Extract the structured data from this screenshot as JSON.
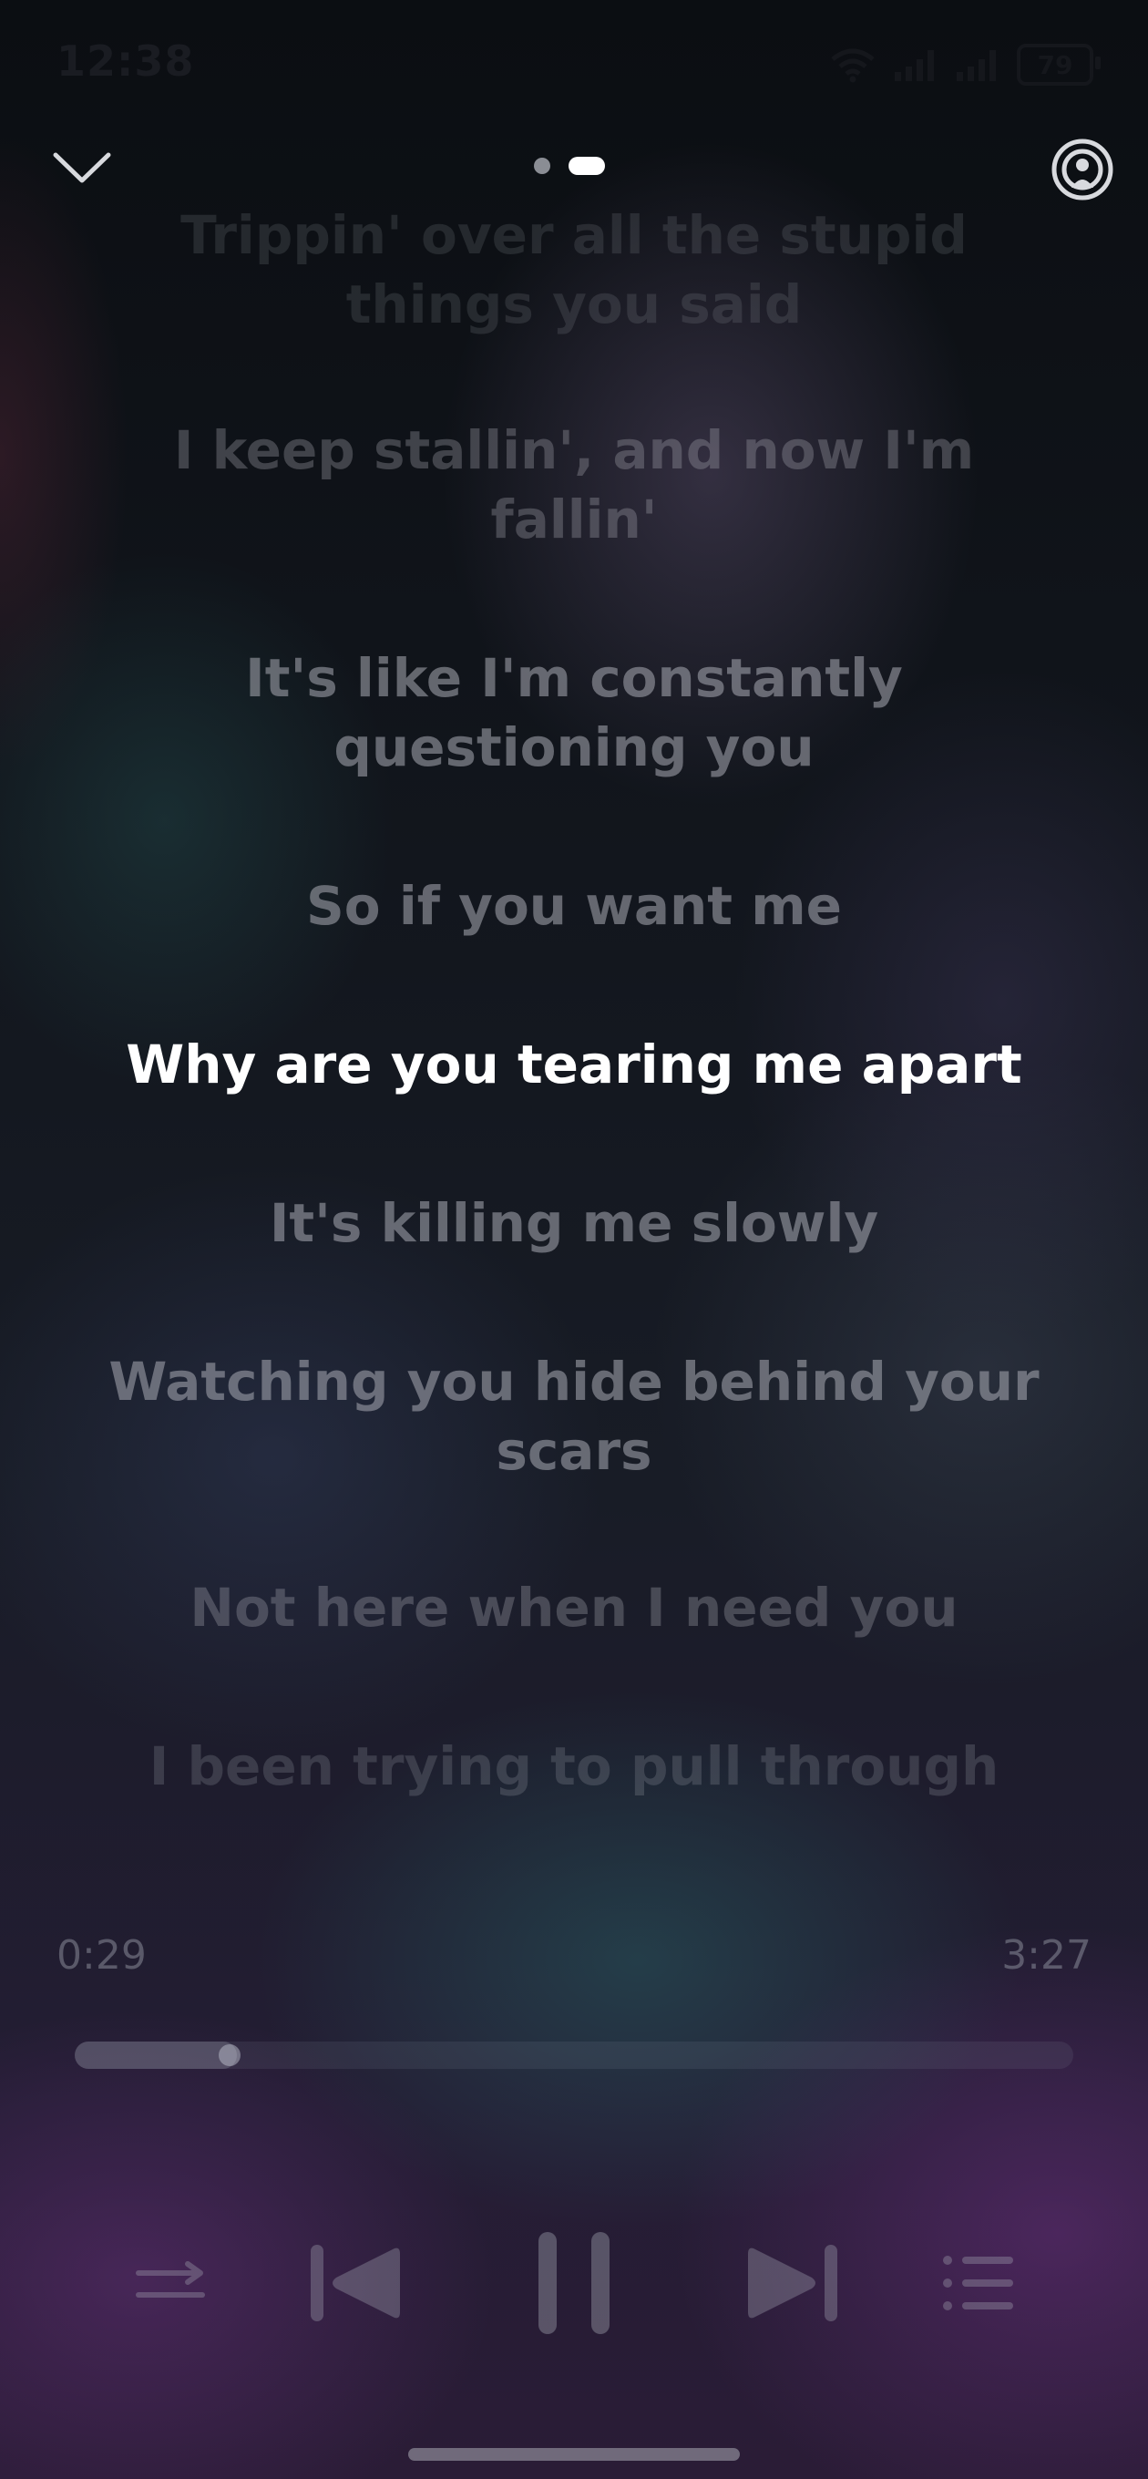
{
  "status_bar": {
    "time": "12:38",
    "battery_level": "79",
    "icons": [
      "wifi-icon",
      "signal-icon",
      "signal-icon",
      "battery-icon"
    ]
  },
  "nav": {
    "collapse_icon": "chevron-down-icon",
    "page_count": 2,
    "active_page": 2,
    "cast_icon": "cast-icon"
  },
  "lyrics": {
    "lines": [
      "Trippin' over all the stupid things you said",
      "I keep stallin', and now I'm fallin'",
      "It's like I'm constantly questioning you",
      "So if you want me",
      "Why are you tearing me apart",
      "It's killing me slowly",
      "Watching you hide behind your scars",
      "Not here when I need you",
      "I been trying to pull through"
    ],
    "current_index": 4
  },
  "playback": {
    "elapsed": "0:29",
    "total": "3:27",
    "progress_fraction": 0.15
  },
  "controls": {
    "repeat_icon": "repeat-icon",
    "previous_icon": "previous-icon",
    "pause_icon": "pause-icon",
    "next_icon": "next-icon",
    "playlist_icon": "playlist-icon"
  },
  "colors": {
    "current_lyric": "#ffffff",
    "inactive_lyric": "#aaacb4"
  }
}
